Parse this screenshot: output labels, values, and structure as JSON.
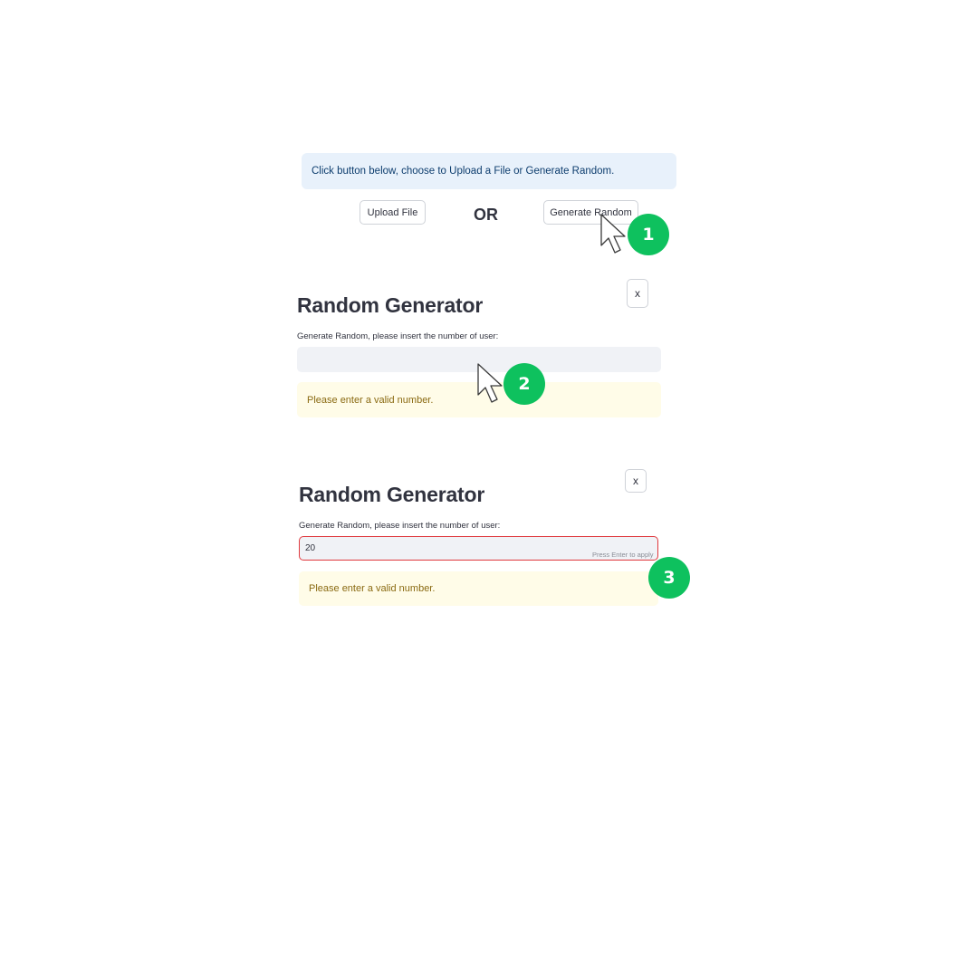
{
  "step1": {
    "info_text": "Click button below, choose to Upload a File or Generate Random.",
    "upload_label": "Upload File",
    "or_label": "OR",
    "generate_label": "Generate Random"
  },
  "panel_empty": {
    "close_label": "x",
    "title": "Random Generator",
    "input_label": "Generate Random, please insert the number of user:",
    "input_value": "",
    "warning": "Please enter a valid number."
  },
  "panel_filled": {
    "close_label": "x",
    "title": "Random Generator",
    "input_label": "Generate Random, please insert the number of user:",
    "input_value": "20",
    "hint": "Press Enter to apply",
    "warning": "Please enter a valid number."
  },
  "annotations": {
    "step_1": "1",
    "step_2": "2",
    "step_3": "3",
    "badge_color": "#0ec15e",
    "cursor_icon": "arrow-cursor-icon"
  }
}
